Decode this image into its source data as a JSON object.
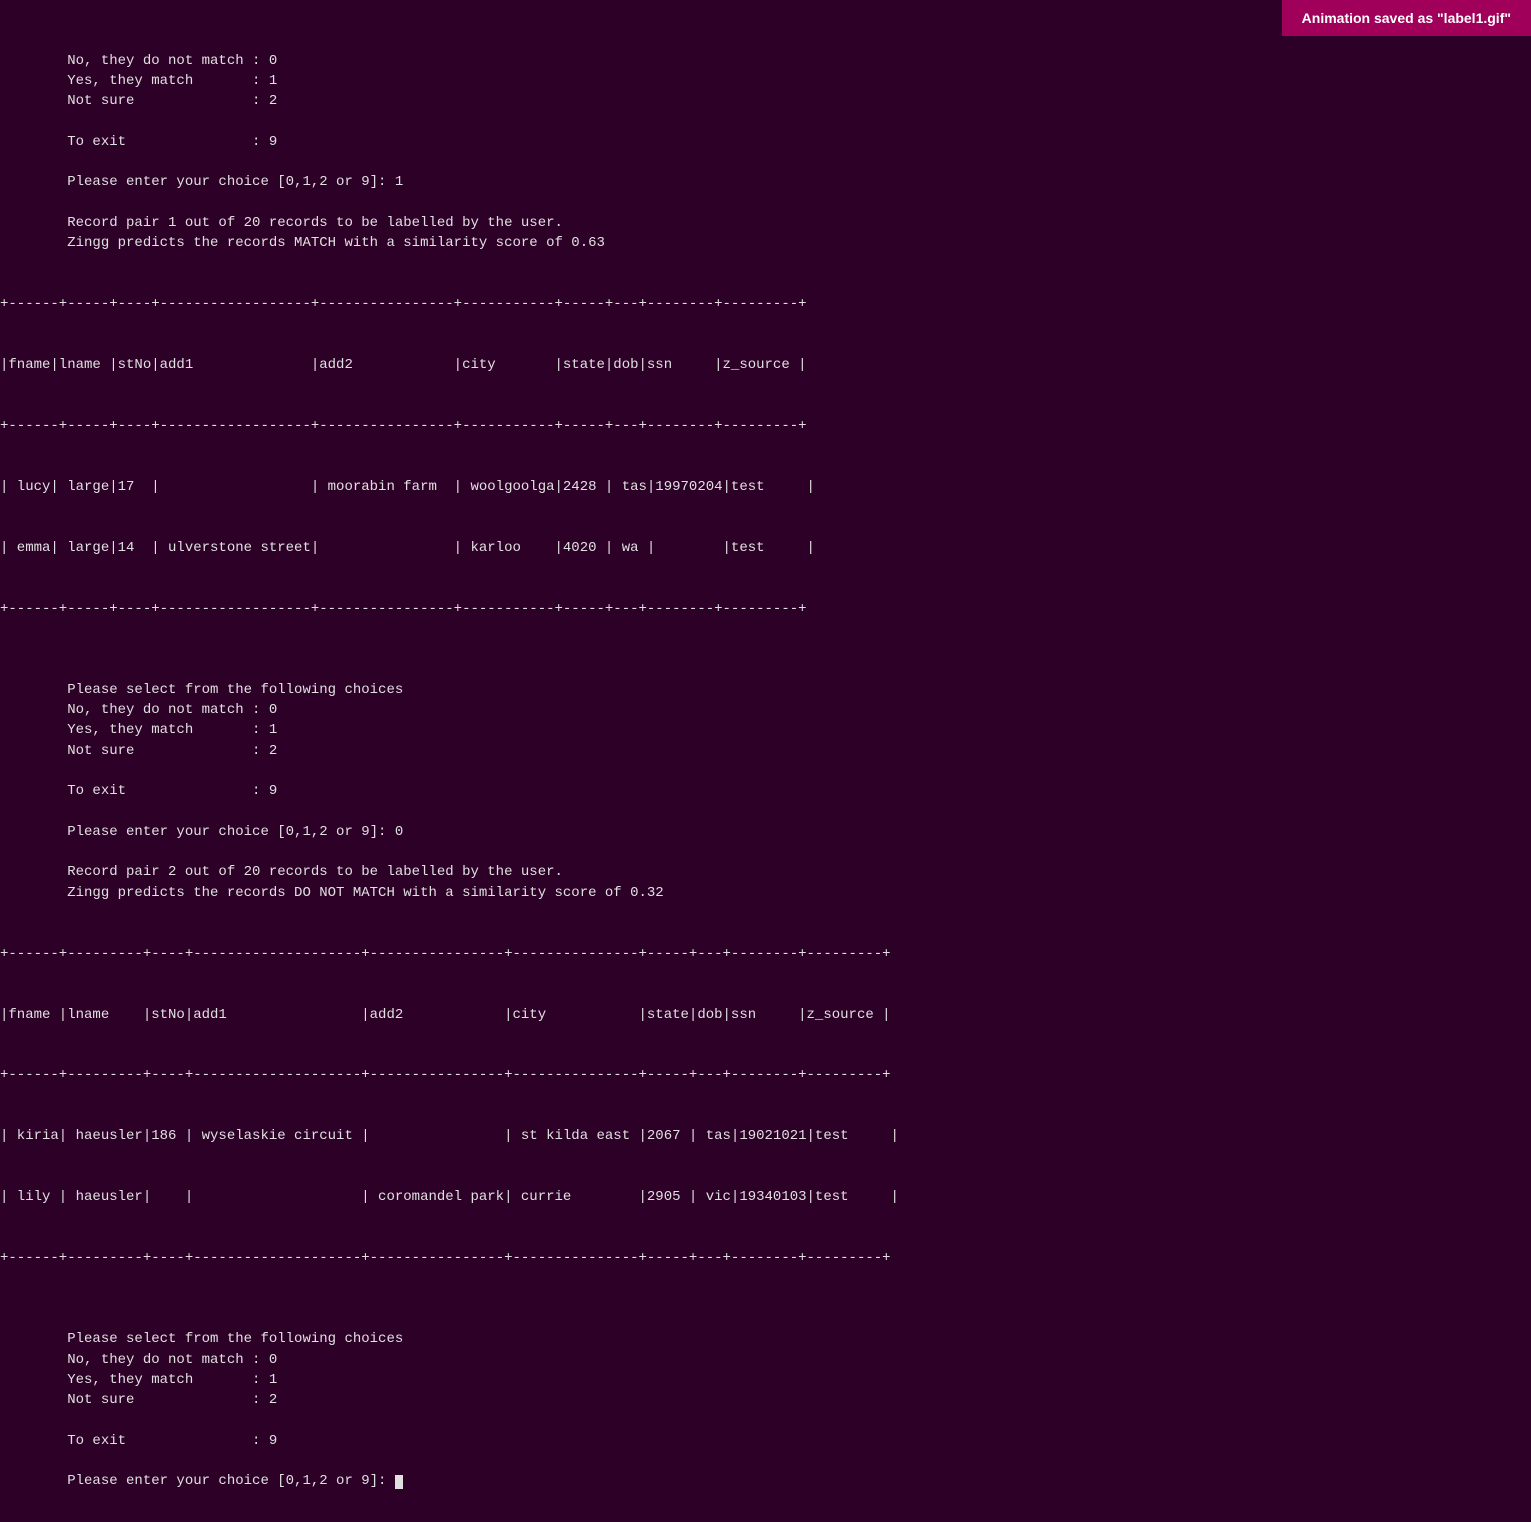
{
  "notification": {
    "text": "Animation saved as \"label1.gif\""
  },
  "terminal": {
    "lines": [
      "No, they do not match : 0",
      "Yes, they match       : 1",
      "Not sure              : 2",
      "",
      "To exit               : 9",
      "",
      "    Please enter your choice [0,1,2 or 9]: 1",
      "",
      "    Record pair 1 out of 20 records to be labelled by the user.",
      "    Zingg predicts the records MATCH with a similarity score of 0.63"
    ],
    "table1_border_top": "+------+-----+----+------------------+----------------+-----------+-----+---+--------+----------+",
    "table1_header": "|fname|lname |stNo|add1              |add2            |city       |state|dob|ssn     |z_source  |",
    "table1_border_mid": "+------+-----+----+------------------+----------------+-----------+-----+---+--------+----------+",
    "table1_row1": "| lucy| large|17  |                  | moorabin farm  | woolgoolga|2428 | tas|19970204|test      |",
    "table1_row2": "| emma| large|14  | ulverstone street|                | karloo    |4020 | wa |        |test      |",
    "table1_border_bot": "+------+-----+----+------------------+----------------+-----------+-----+---+--------+----------+",
    "lines2": [
      "",
      "        Please select from the following choices",
      "        No, they do not match : 0",
      "        Yes, they match       : 1",
      "        Not sure              : 2",
      "",
      "        To exit               : 9",
      "",
      "        Please enter your choice [0,1,2 or 9]: 0",
      "",
      "        Record pair 2 out of 20 records to be labelled by the user.",
      "        Zingg predicts the records DO NOT MATCH with a similarity score of 0.32"
    ],
    "table2_border_top": "+------+---------+----+--------------------+----------------+---------------+-----+---+--------+----------+",
    "table2_header": "|fname |lname    |stNo|add1                |add2            |city           |state|dob|ssn     |z_source  |",
    "table2_border_mid": "+------+---------+----+--------------------+----------------+---------------+-----+---+--------+----------+",
    "table2_row1": "| kiria| haeusler|186 | wyselaskie circuit |                | st kilda east |2067 | tas|19021021|test      |",
    "table2_row2": "| lily | haeusler|    |                    | coromandel park| currie        |2905 | vic|19340103|test      |",
    "table2_border_bot": "+------+---------+----+--------------------+----------------+---------------+-----+---+--------+----------+",
    "lines3": [
      "",
      "        Please select from the following choices",
      "        No, they do not match : 0",
      "        Yes, they match       : 1",
      "        Not sure              : 2",
      "",
      "        To exit               : 9",
      "",
      "        Please enter your choice [0,1,2 or 9]: "
    ]
  }
}
